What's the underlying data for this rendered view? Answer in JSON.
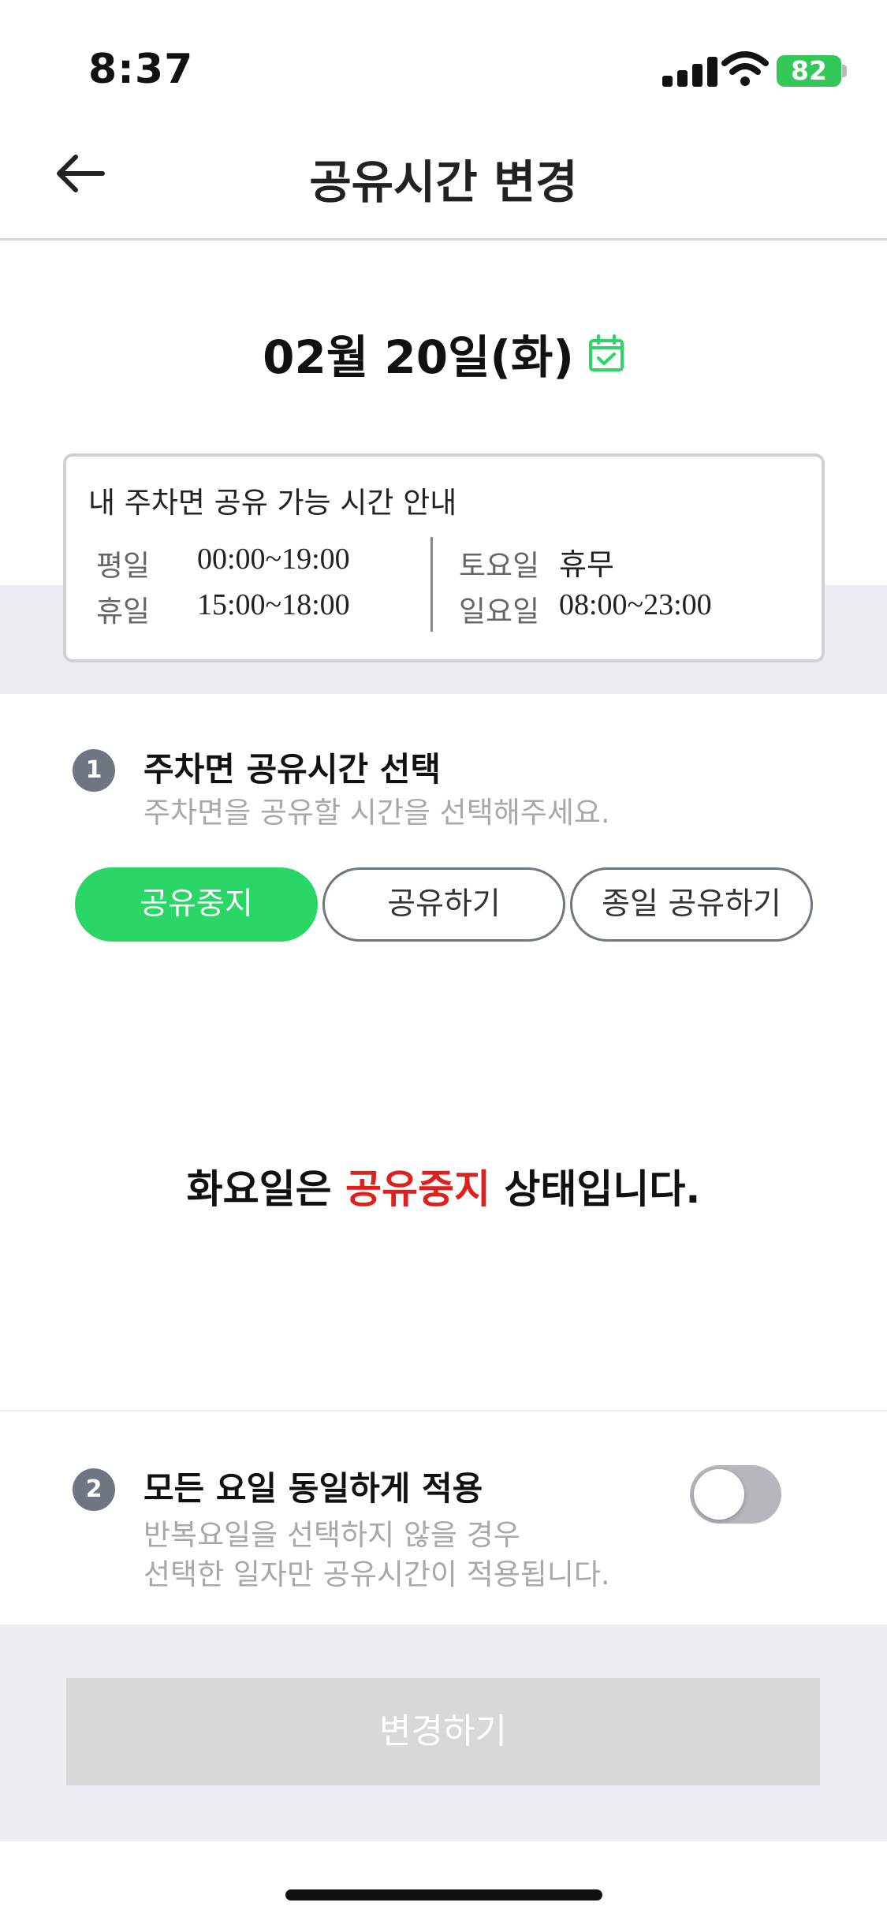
{
  "status_bar": {
    "time": "8:37",
    "battery": "82"
  },
  "nav": {
    "title": "공유시간 변경",
    "back_icon": "arrow-left-icon"
  },
  "date": {
    "text": "02월 20일(화)",
    "icon": "calendar-check-icon",
    "icon_color": "#2ad666"
  },
  "info": {
    "title": "내 주차면 공유 가능 시간 안내",
    "rows": [
      {
        "label": "평일",
        "value": "00:00~19:00"
      },
      {
        "label": "휴일",
        "value": "15:00~18:00"
      },
      {
        "label": "토요일",
        "value": "휴무"
      },
      {
        "label": "일요일",
        "value": "08:00~23:00"
      }
    ]
  },
  "section1": {
    "number": "1",
    "title": "주차면 공유시간 선택",
    "subtitle": "주차면을 공유할 시간을 선택해주세요.",
    "options": [
      {
        "label": "공유중지",
        "selected": true
      },
      {
        "label": "공유하기",
        "selected": false
      },
      {
        "label": "종일 공유하기",
        "selected": false
      }
    ]
  },
  "status_message": {
    "prefix": "화요일은 ",
    "highlight": "공유중지",
    "suffix": " 상태입니다.",
    "highlight_color": "#e0201c"
  },
  "section2": {
    "number": "2",
    "title": "모든 요일 동일하게 적용",
    "subtitle_line1": "반복요일을 선택하지 않을 경우",
    "subtitle_line2": "선택한 일자만 공유시간이 적용됩니다.",
    "toggle_on": false
  },
  "submit": {
    "label": "변경하기"
  },
  "colors": {
    "accent": "#2ad666",
    "alert": "#e0201c",
    "badge": "#6e7681"
  }
}
